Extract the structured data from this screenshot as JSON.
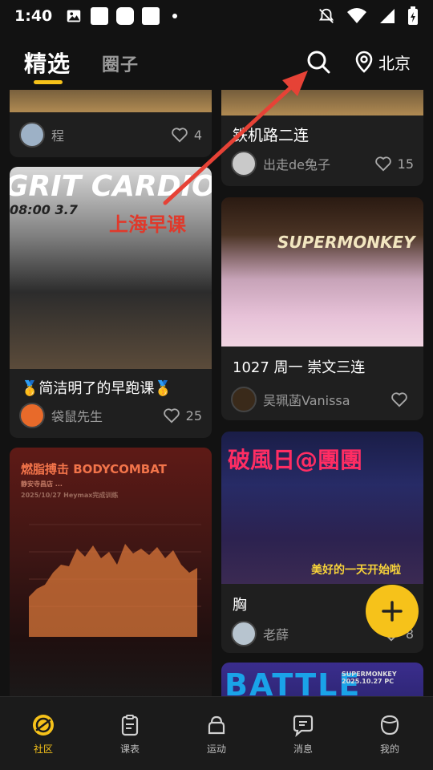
{
  "status": {
    "time": "1:40"
  },
  "header": {
    "tab_active": "精选",
    "tab_inactive": "圈子",
    "location": "北京"
  },
  "colors": {
    "accent": "#f6c21a",
    "background": "#121212",
    "card": "#1f1f1f",
    "annotation_arrow": "#e64236"
  },
  "feed": {
    "cards": [
      {
        "author": "程",
        "likes": "4"
      },
      {
        "title": "铁机路二连",
        "author": "出走de兔子",
        "likes": "15"
      },
      {
        "overlay_top": "GRIT CARDIO",
        "overlay_time": "08:00 3.7",
        "overlay_red": "上海早课",
        "title": "🥇简洁明了的早跑课🥇",
        "author": "袋鼠先生",
        "likes": "25"
      },
      {
        "overlay_top": "SUPERMONKEY",
        "title": "1027 周一 崇文三连",
        "author": "吴珮菡Vanissa",
        "likes": ""
      },
      {
        "overlay_top": "燃脂搏击 BODYCOMBAT",
        "overlay_sub": "静安寺昌店 ...",
        "overlay_date": "2025/10/27 Heymax完成训练"
      },
      {
        "overlay_top": "破風日@團團",
        "overlay_bottom": "美好的一天开始啦",
        "title": "胸",
        "author": "老薛",
        "likes": "8"
      },
      {
        "overlay_top": "BATTLE",
        "overlay_stamp": "SUPERMONKEY 2025.10.27 PC"
      }
    ]
  },
  "nav": {
    "items": [
      {
        "label": "社区",
        "icon": "community-icon"
      },
      {
        "label": "课表",
        "icon": "schedule-icon"
      },
      {
        "label": "运动",
        "icon": "sport-icon"
      },
      {
        "label": "消息",
        "icon": "message-icon"
      },
      {
        "label": "我的",
        "icon": "profile-icon"
      }
    ]
  }
}
